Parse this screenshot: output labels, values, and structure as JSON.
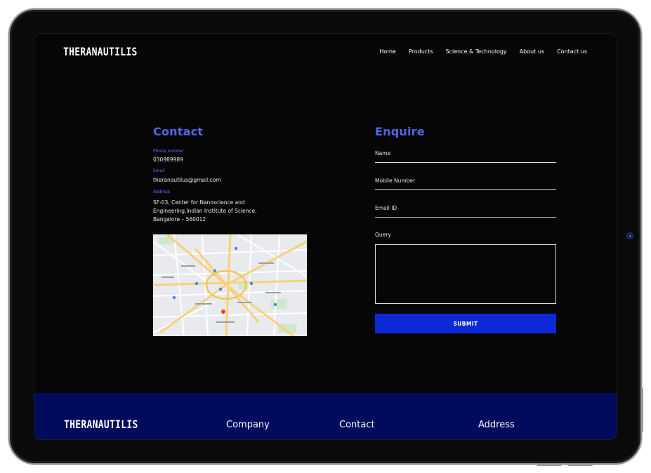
{
  "header": {
    "logo": "THERANAUTILIS",
    "nav": [
      "Home",
      "Products",
      "Science & Technology",
      "About us",
      "Contact us"
    ]
  },
  "contact": {
    "title": "Contact",
    "phone_label": "Phone number",
    "phone": "030989989",
    "email_label": "Email",
    "email": "theranautilus@gmail.com",
    "address_label": "Address",
    "address_lines": [
      "SF-03, Center for Nanoscience and",
      "Engineering,Indian Institute of Science,",
      "Bangalore – 560012"
    ]
  },
  "enquire": {
    "title": "Enquire",
    "fields": [
      "Name",
      "Mobile Number",
      "Email ID"
    ],
    "query_label": "Query",
    "submit": "SUBMIT"
  },
  "footer": {
    "logo": "THERANAUTILIS",
    "headings": [
      "Company",
      "Contact",
      "Address"
    ]
  },
  "colors": {
    "accent": "#4f67e6",
    "button": "#0b2ad6",
    "footer_bg": "#000b5e"
  }
}
